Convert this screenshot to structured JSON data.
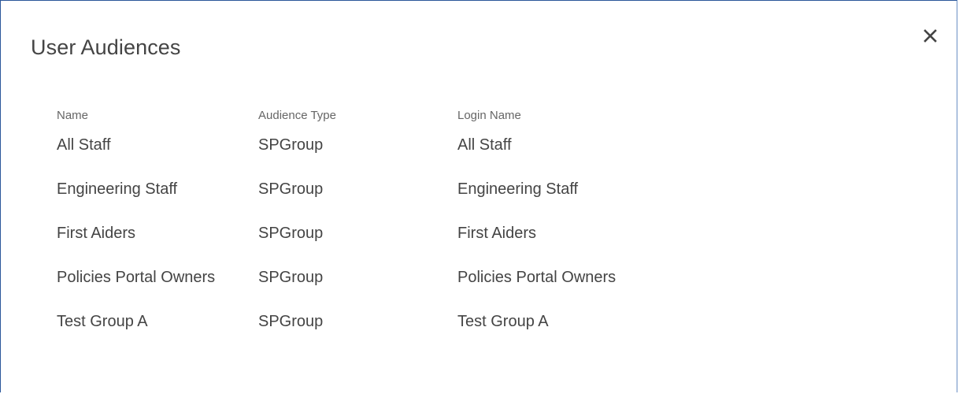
{
  "dialog": {
    "title": "User Audiences",
    "close_icon": "close-icon"
  },
  "table": {
    "columns": {
      "name": "Name",
      "audience_type": "Audience Type",
      "login_name": "Login Name"
    },
    "rows": [
      {
        "name": "All Staff",
        "audience_type": "SPGroup",
        "login_name": "All Staff"
      },
      {
        "name": "Engineering Staff",
        "audience_type": "SPGroup",
        "login_name": "Engineering Staff"
      },
      {
        "name": "First Aiders",
        "audience_type": "SPGroup",
        "login_name": "First Aiders"
      },
      {
        "name": "Policies Portal Owners",
        "audience_type": "SPGroup",
        "login_name": "Policies Portal Owners"
      },
      {
        "name": "Test Group A",
        "audience_type": "SPGroup",
        "login_name": "Test Group A"
      }
    ]
  },
  "colors": {
    "border": "#2b579a",
    "title_text": "#444444",
    "header_text": "#666666",
    "cell_text": "#444444"
  }
}
